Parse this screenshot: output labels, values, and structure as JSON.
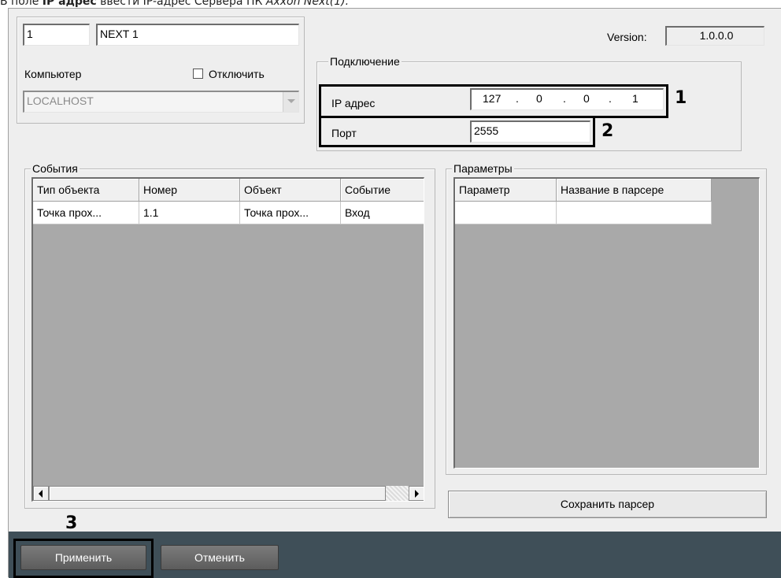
{
  "caption": {
    "prefix": "В поле ",
    "field_name": "IP адрес",
    "middle": " ввести IP-адрес Сервера ПК ",
    "product": "Axxon Next",
    "suffix": "(1)."
  },
  "object": {
    "id_value": "1",
    "name_value": "NEXT 1",
    "computer_label": "Компьютер",
    "computer_value": "LOCALHOST",
    "disable_label": "Отключить",
    "disable_checked": false
  },
  "version": {
    "label": "Version:",
    "value": "1.0.0.0"
  },
  "connection": {
    "title": "Подключение",
    "ip_label": "IP адрес",
    "ip_octets": [
      "127",
      "0",
      "0",
      "1"
    ],
    "ip_separator": ".",
    "port_label": "Порт",
    "port_value": "2555"
  },
  "events": {
    "title": "События",
    "columns": [
      "Тип объекта",
      "Номер",
      "Объект",
      "Событие"
    ],
    "rows": [
      [
        "Точка прох...",
        "1.1",
        "Точка прох...",
        "Вход"
      ]
    ]
  },
  "parameters": {
    "title": "Параметры",
    "columns": [
      "Параметр",
      "Название в парсере"
    ],
    "rows": [
      [
        "",
        ""
      ]
    ]
  },
  "buttons": {
    "save_parser": "Сохранить парсер",
    "apply": "Применить",
    "cancel": "Отменить"
  },
  "callouts": {
    "ip": "1",
    "port": "2",
    "apply": "3"
  },
  "colors": {
    "panel_bg": "#eeeeee",
    "grid_bg": "#a9a9a9",
    "bottom_bar": "#3f4f58"
  }
}
